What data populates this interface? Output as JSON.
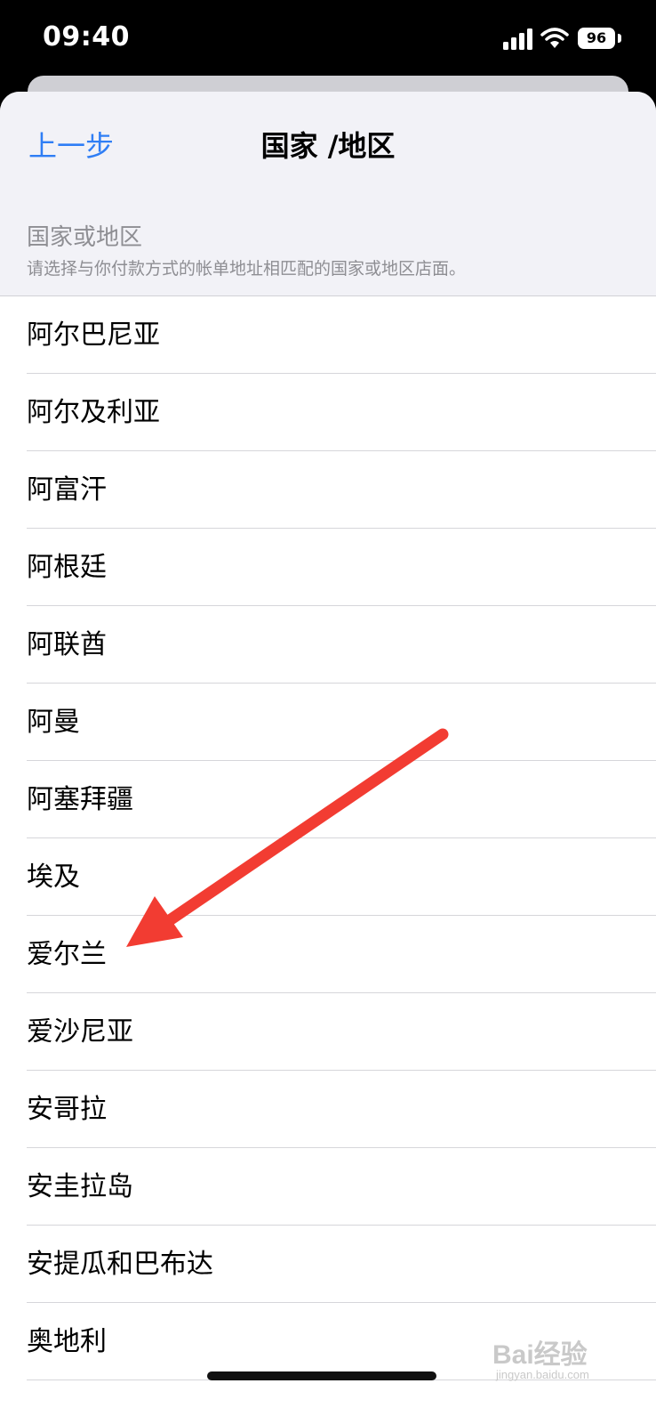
{
  "status_bar": {
    "time": "09:40",
    "battery": "96",
    "icons": [
      "cellular-signal-icon",
      "wifi-icon",
      "battery-icon"
    ]
  },
  "nav": {
    "back_label": "上一步",
    "title": "国家 /地区"
  },
  "section": {
    "header": "国家或地区",
    "subtitle": "请选择与你付款方式的帐单地址相匹配的国家或地区店面。"
  },
  "countries": [
    "阿尔巴尼亚",
    "阿尔及利亚",
    "阿富汗",
    "阿根廷",
    "阿联酋",
    "阿曼",
    "阿塞拜疆",
    "埃及",
    "爱尔兰",
    "爱沙尼亚",
    "安哥拉",
    "安圭拉岛",
    "安提瓜和巴布达",
    "奥地利"
  ],
  "annotation": {
    "type": "red-arrow",
    "points_to": "爱尔兰",
    "color": "#f23c32"
  },
  "watermark": {
    "brand": "Bai经验",
    "sub": "jingyan.baidu.com"
  },
  "colors": {
    "accent": "#2f7ef5",
    "header_bg": "#f2f2f7",
    "secondary_text": "#8e8e93"
  }
}
